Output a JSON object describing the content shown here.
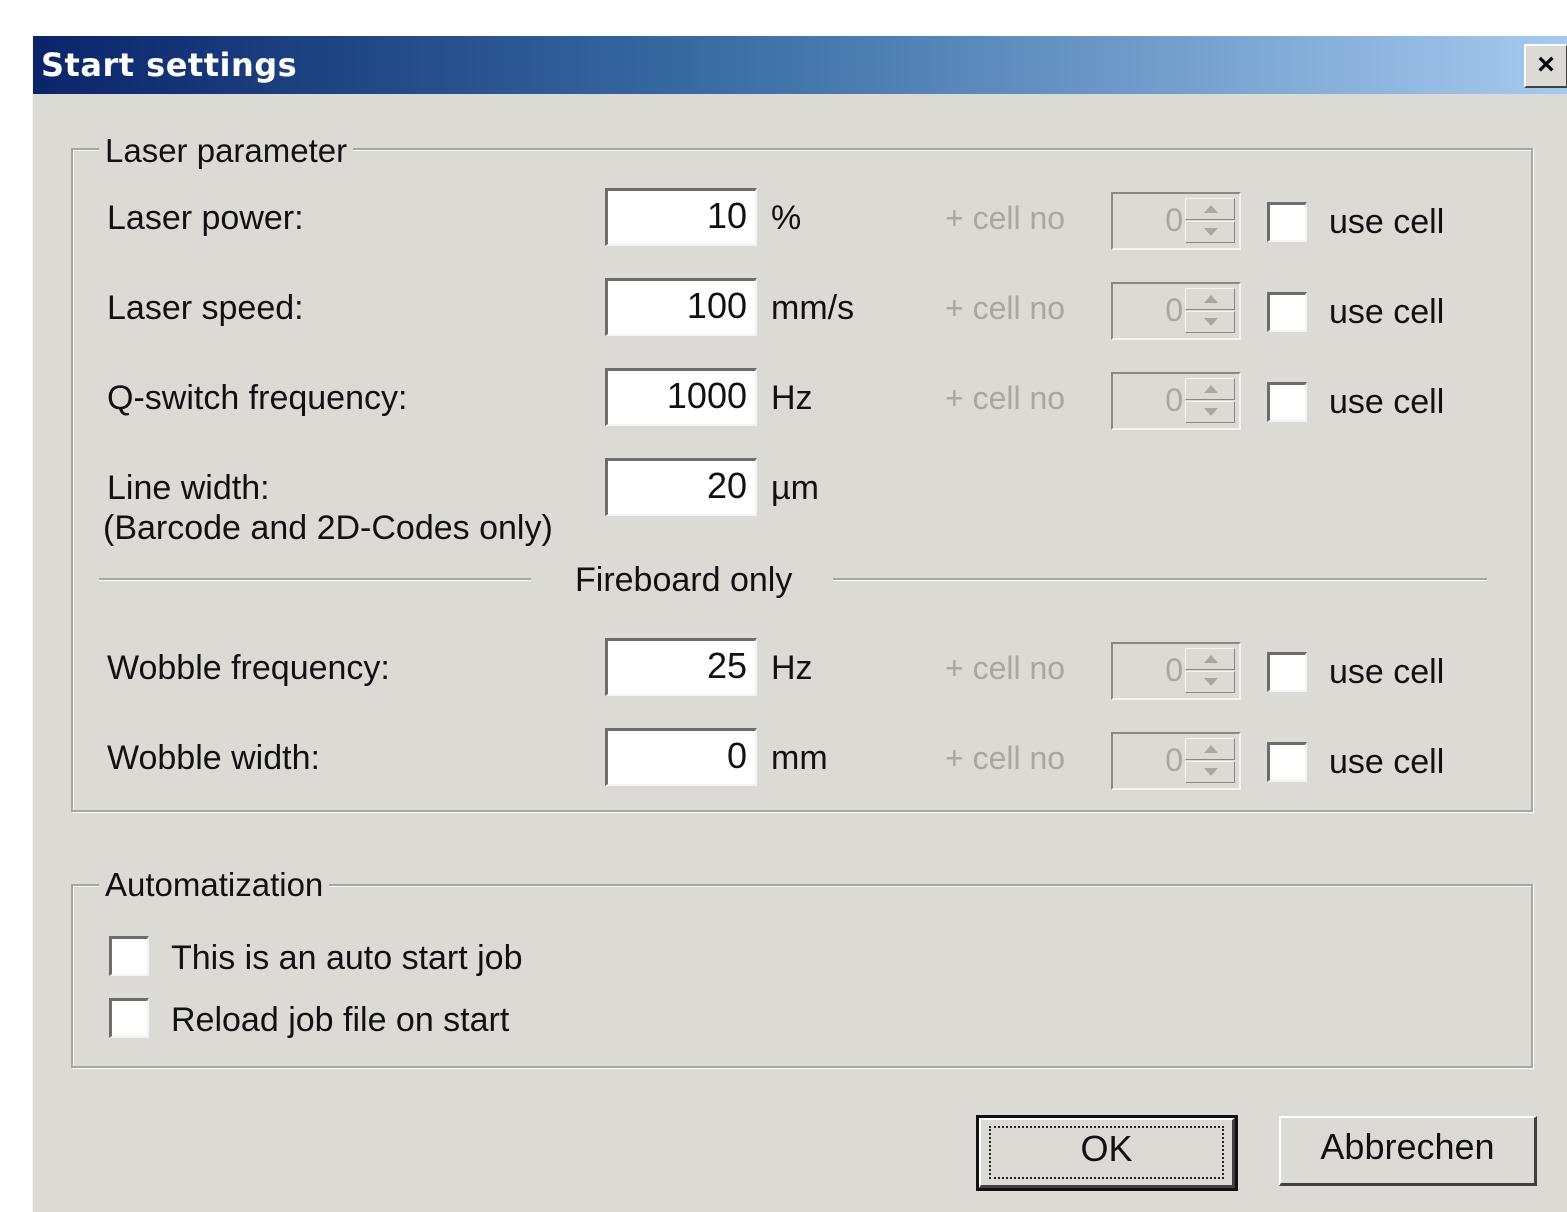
{
  "window": {
    "title": "Start settings",
    "close_label": "×"
  },
  "laser_group": {
    "legend": "Laser parameter",
    "rows": [
      {
        "label": "Laser power:",
        "value": "10",
        "unit": "%",
        "cell_label": "+ cell no",
        "cell_value": "0",
        "use_cell_label": "use cell"
      },
      {
        "label": "Laser speed:",
        "value": "100",
        "unit": "mm/s",
        "cell_label": "+ cell no",
        "cell_value": "0",
        "use_cell_label": "use cell"
      },
      {
        "label": "Q-switch frequency:",
        "value": "1000",
        "unit": "Hz",
        "cell_label": "+ cell no",
        "cell_value": "0",
        "use_cell_label": "use cell"
      }
    ],
    "line_width": {
      "label": "Line width:",
      "sublabel": "(Barcode and 2D-Codes only)",
      "value": "20",
      "unit": "µm"
    },
    "fireboard_heading": "Fireboard only",
    "fireboard_rows": [
      {
        "label": "Wobble frequency:",
        "value": "25",
        "unit": "Hz",
        "cell_label": "+ cell no",
        "cell_value": "0",
        "use_cell_label": "use cell"
      },
      {
        "label": "Wobble width:",
        "value": "0",
        "unit": "mm",
        "cell_label": "+ cell no",
        "cell_value": "0",
        "use_cell_label": "use cell"
      }
    ]
  },
  "automation_group": {
    "legend": "Automatization",
    "options": [
      {
        "label": "This is an auto start job",
        "checked": false
      },
      {
        "label": "Reload job file on start",
        "checked": false
      }
    ]
  },
  "buttons": {
    "ok": "OK",
    "cancel": "Abbrechen"
  },
  "colors": {
    "dialog_bg": "#dcdad5",
    "title_start": "#0a246a",
    "title_end": "#a6caf0",
    "disabled_text": "#a9a7a2"
  }
}
